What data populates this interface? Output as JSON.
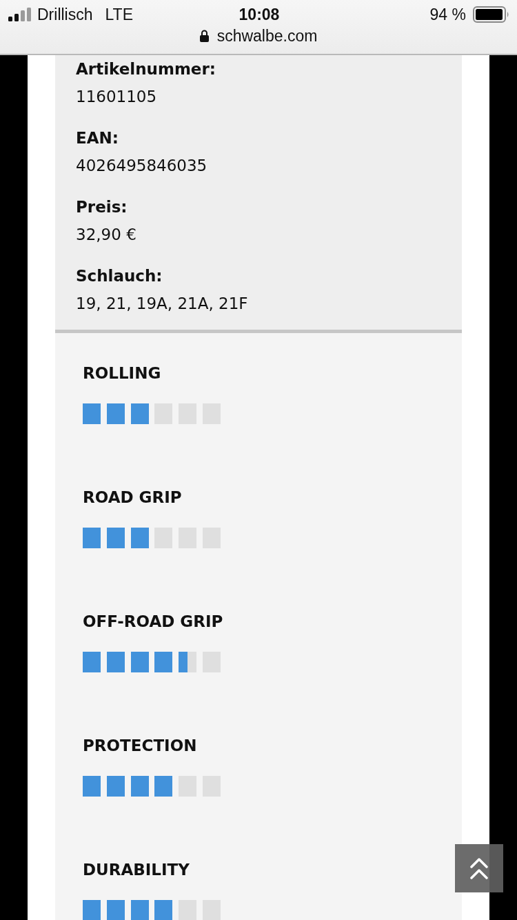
{
  "status_bar": {
    "carrier": "Drillisch",
    "network": "LTE",
    "time": "10:08",
    "battery": "94 %"
  },
  "address_bar": {
    "url": "schwalbe.com"
  },
  "specs": [
    {
      "label": "Artikelnummer:",
      "value": "11601105"
    },
    {
      "label": "EAN:",
      "value": "4026495846035"
    },
    {
      "label": "Preis:",
      "value": "32,90 €"
    },
    {
      "label": "Schlauch:",
      "value": "19, 21, 19A, 21A, 21F"
    }
  ],
  "ratings": [
    {
      "label": "ROLLING",
      "stars": 3
    },
    {
      "label": "ROAD GRIP",
      "stars": 3
    },
    {
      "label": "OFF-ROAD GRIP",
      "stars": 4.5
    },
    {
      "label": "PROTECTION",
      "stars": 4
    },
    {
      "label": "DURABILITY",
      "stars": 4
    }
  ]
}
